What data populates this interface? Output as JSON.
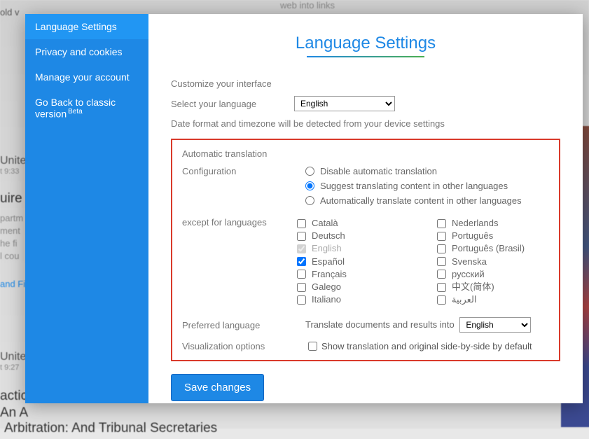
{
  "sidebar": {
    "items": [
      {
        "label": "Language Settings"
      },
      {
        "label": "Privacy and cookies"
      },
      {
        "label": "Manage your account"
      },
      {
        "label": "Go Back to classic version",
        "badge": "Beta"
      }
    ]
  },
  "title": "Language Settings",
  "customize_heading": "Customize your interface",
  "select_language_label": "Select your language",
  "language_select_value": "English",
  "date_note": "Date format and timezone will be detected from your device settings",
  "auto_translation_title": "Automatic translation",
  "configuration_label": "Configuration",
  "radios": {
    "disable": "Disable automatic translation",
    "suggest": "Suggest translating content in other languages",
    "auto": "Automatically translate content in other languages"
  },
  "except_label": "except for languages",
  "lang_cols": {
    "left": [
      {
        "label": "Català",
        "checked": false,
        "disabled": false
      },
      {
        "label": "Deutsch",
        "checked": false,
        "disabled": false
      },
      {
        "label": "English",
        "checked": true,
        "disabled": true
      },
      {
        "label": "Español",
        "checked": true,
        "disabled": false
      },
      {
        "label": "Français",
        "checked": false,
        "disabled": false
      },
      {
        "label": "Galego",
        "checked": false,
        "disabled": false
      },
      {
        "label": "Italiano",
        "checked": false,
        "disabled": false
      }
    ],
    "right": [
      {
        "label": "Nederlands",
        "checked": false,
        "disabled": false
      },
      {
        "label": "Português",
        "checked": false,
        "disabled": false
      },
      {
        "label": "Português (Brasil)",
        "checked": false,
        "disabled": false
      },
      {
        "label": "Svenska",
        "checked": false,
        "disabled": false
      },
      {
        "label": "русский",
        "checked": false,
        "disabled": false
      },
      {
        "label": "中文(简体)",
        "checked": false,
        "disabled": false
      },
      {
        "label": "العربية",
        "checked": false,
        "disabled": false
      }
    ]
  },
  "preferred_label": "Preferred language",
  "translate_into_label": "Translate documents and results into",
  "translate_into_value": "English",
  "visualization_label": "Visualization options",
  "side_by_side_label": "Show translation and original side-by-side by default",
  "save_label": "Save changes",
  "bg": {
    "t1": "old v",
    "t2": "Unite",
    "t3": "t 9:33",
    "t4": "uire",
    "t5": "partm",
    "t6": "ment",
    "t7": "he fi",
    "t8": "l cou",
    "t9": "and Fi",
    "t10": "Unite",
    "t11": "t 9:27",
    "t12": "actic",
    "t13": "An A",
    "t14": "Arbitration: And Tribunal Secretaries",
    "t15": "web into links"
  }
}
